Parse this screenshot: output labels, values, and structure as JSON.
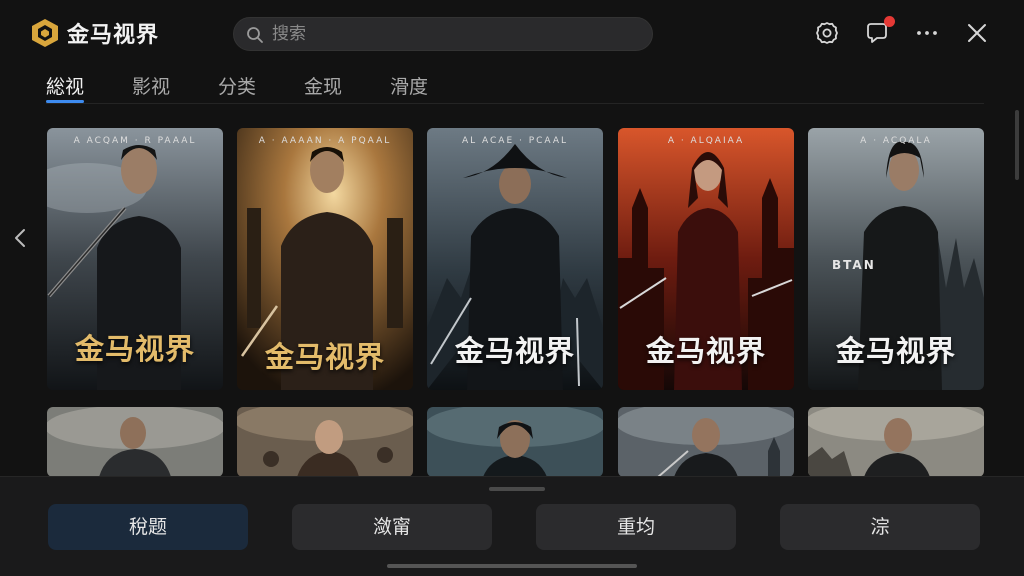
{
  "app": {
    "title": "金马视界"
  },
  "search": {
    "placeholder": "搜索"
  },
  "tabs": [
    {
      "label": "総视",
      "active": true
    },
    {
      "label": "影视",
      "active": false
    },
    {
      "label": "分类",
      "active": false
    },
    {
      "label": "金现",
      "active": false
    },
    {
      "label": "滑度",
      "active": false
    }
  ],
  "posters": [
    {
      "title": "金马视界",
      "tagline": "A ACQAM · R PAAAL"
    },
    {
      "title": "金马视界",
      "tagline": "A · AAAAN · A PQAAL"
    },
    {
      "title": "金马视界",
      "tagline": "AL ACAE · PCAAL"
    },
    {
      "title": "金马视界",
      "tagline": "A · ALQAIAA"
    },
    {
      "title": "金马视界",
      "tagline": "A · ACQALA"
    }
  ],
  "poster4_side_text": "BTAN",
  "bottom_actions": [
    {
      "label": "稅题"
    },
    {
      "label": "潋甯"
    },
    {
      "label": "重均"
    },
    {
      "label": "淙"
    }
  ],
  "colors": {
    "accent": "#3d8bef",
    "badge": "#e53935",
    "logo_gold": "#d9a63c"
  },
  "icons": [
    "logo-icon",
    "search-icon",
    "settings-icon",
    "notification-icon",
    "more-icon",
    "close-icon",
    "chevron-left-icon"
  ]
}
